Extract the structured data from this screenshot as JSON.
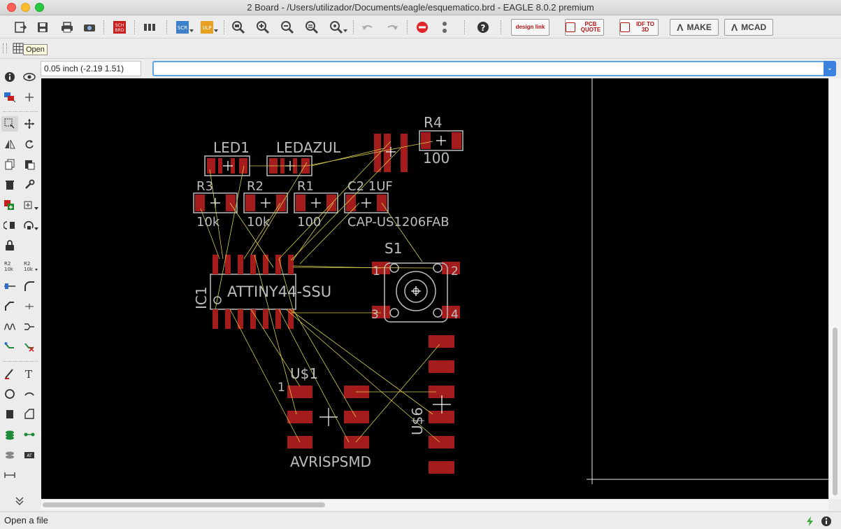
{
  "window": {
    "title": "2 Board - /Users/utilizador/Documents/eagle/esquematico.brd - EAGLE 8.0.2 premium"
  },
  "toolbar": {
    "sch_label": "SCH BRD",
    "scr_label": "SCR",
    "ulp_label": "ULP",
    "designlink_label": "design link",
    "pcbquote_label": "PCB QUOTE",
    "idf_label": "IDF TO 3D",
    "make_label": "MAKE",
    "mcad_label": "MCAD"
  },
  "tooltip": {
    "text": "Open"
  },
  "command": {
    "coordinates": "0.05 inch (-2.19 1.51)",
    "input_value": ""
  },
  "status": {
    "text": "Open a file"
  },
  "board": {
    "labels": {
      "led1": "LED1",
      "ledazul": "LEDAZUL",
      "r4": "R4",
      "r4_value": "100",
      "r3": "R3",
      "r2": "R2",
      "r1": "R1",
      "c2": "C2 1UF",
      "r3_value": "10k",
      "r2_value": "10k",
      "r1_value": "100",
      "c2_value": "CAP-US1206FAB",
      "s1": "S1",
      "s1_pin1": "1",
      "s1_pin2": "2",
      "s1_pin3": "3",
      "s1_pin4": "4",
      "ic1_value": "ATTINY44-SSU",
      "ic1": "IC1",
      "us1": "U$1",
      "us1_pin1": "1",
      "us1_value": "AVRISPSMD",
      "us6": "U$6"
    },
    "colors": {
      "background": "#000000",
      "pad": "#a41b1b",
      "silk": "#bdbdbd",
      "airwire": "#d8cc50"
    }
  }
}
